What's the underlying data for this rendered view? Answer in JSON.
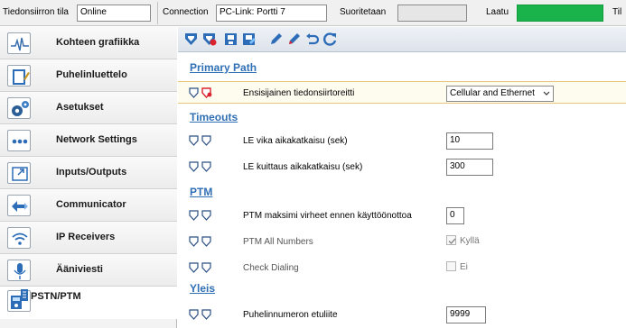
{
  "statusbar": {
    "connection_state_label": "Tiedonsiirron tila",
    "connection_state_value": "Online",
    "connection_label": "Connection",
    "connection_value": "PC-Link: Portti 7",
    "running_label": "Suoritetaan",
    "quality_label": "Laatu",
    "cut_label": "Til",
    "quality_color": "#19b24b"
  },
  "sidebar": {
    "items": [
      {
        "label": "Kohteen grafiikka",
        "icon": "graph-icon"
      },
      {
        "label": "Puhelinluettelo",
        "icon": "phonebook-icon"
      },
      {
        "label": "Asetukset",
        "icon": "settings-gears-icon"
      },
      {
        "label": "Network Settings",
        "icon": "network-dots-icon"
      },
      {
        "label": "Inputs/Outputs",
        "icon": "inputs-outputs-icon"
      },
      {
        "label": "Communicator",
        "icon": "communicator-icon"
      },
      {
        "label": "IP Receivers",
        "icon": "wifi-icon"
      },
      {
        "label": "Ääniviesti",
        "icon": "microphone-icon"
      },
      {
        "label": "PSTN/PTM",
        "icon": "pstn-ptm-icon"
      }
    ],
    "active_index": 8
  },
  "toolbar": {
    "buttons": [
      "read-all-icon",
      "read-changed-icon",
      "write-icon",
      "write-changed-icon",
      "edit-icon",
      "edit-alt-icon",
      "undo-icon",
      "refresh-icon"
    ]
  },
  "sections": {
    "primary_path": {
      "title": "Primary Path",
      "rows": [
        {
          "label": "Ensisijainen tiedonsiirtoreitti",
          "value": "Cellular and Ethernet"
        }
      ]
    },
    "timeouts": {
      "title": "Timeouts",
      "rows": [
        {
          "label": "LE vika aikakatkaisu (sek)",
          "value": "10"
        },
        {
          "label": "LE kuittaus aikakatkaisu (sek)",
          "value": "300"
        }
      ]
    },
    "ptm": {
      "title": "PTM",
      "rows": [
        {
          "label": "PTM maksimi virheet ennen käyttöönottoa",
          "value": "0"
        },
        {
          "label": "PTM All Numbers",
          "value": "Kyllä",
          "checked": true
        },
        {
          "label": "Check Dialing",
          "value": "Ei",
          "checked": false
        }
      ]
    },
    "yleis": {
      "title": "Yleis",
      "rows": [
        {
          "label": "Puhelinnumeron etuliite",
          "value": "9999"
        }
      ]
    }
  },
  "colors": {
    "section_title": "#2f6fb5",
    "highlight_row": "#fefbef",
    "mark_red": "#d9232e"
  }
}
